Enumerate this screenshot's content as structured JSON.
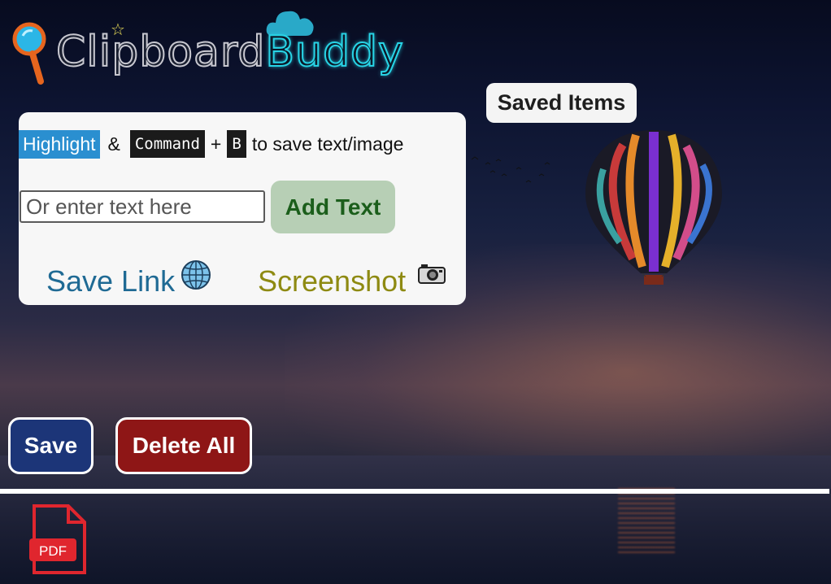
{
  "logo": {
    "word1": "Clipboard",
    "word2": "Buddy"
  },
  "instructions": {
    "highlight": "Highlight",
    "amp": "&",
    "key1": "Command",
    "plus": "+",
    "key2": "B",
    "tail": "to save text/image"
  },
  "input": {
    "placeholder": "Or enter text here",
    "value": ""
  },
  "buttons": {
    "add_text": "Add Text",
    "save_link": "Save Link",
    "screenshot": "Screenshot",
    "saved_items": "Saved Items",
    "save": "Save",
    "delete_all": "Delete All"
  },
  "icons": {
    "logo": "magnifier-icon",
    "globe": "globe-icon",
    "camera": "camera-icon",
    "pdf": "pdf-icon",
    "cloud": "cloud-icon",
    "star": "star-icon"
  },
  "colors": {
    "highlight": "#2a8fd0",
    "add_text_bg": "#b7cfb5",
    "add_text_fg": "#1b5e1b",
    "save_link": "#1f6a94",
    "screenshot": "#8e8a12",
    "save_bg": "#1c3578",
    "delete_bg": "#8e1616"
  }
}
